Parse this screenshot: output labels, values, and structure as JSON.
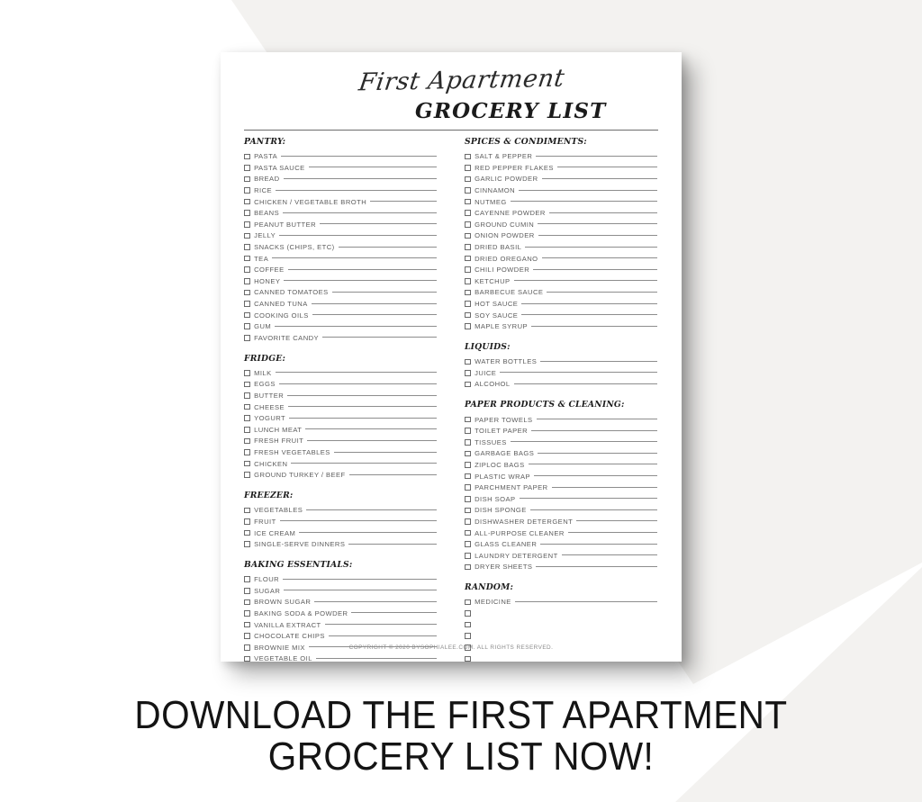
{
  "background": {
    "base_color": "#ffffff",
    "diagonal_color": "#f3f2f0"
  },
  "paper": {
    "title_script": "First Apartment",
    "title_serif": "GROCERY LIST",
    "footer": "COPYRIGHT © 2020 BYSOPHIALEE.COM. ALL RIGHTS RESERVED.",
    "left_column": [
      {
        "heading": "PANTRY:",
        "items": [
          "PASTA",
          "PASTA SAUCE",
          "BREAD",
          "RICE",
          "CHICKEN / VEGETABLE BROTH",
          "BEANS",
          "PEANUT BUTTER",
          "JELLY",
          "SNACKS (CHIPS, ETC)",
          "TEA",
          "COFFEE",
          "HONEY",
          "CANNED TOMATOES",
          "CANNED TUNA",
          "COOKING OILS",
          "GUM",
          "FAVORITE CANDY"
        ]
      },
      {
        "heading": "FRIDGE:",
        "items": [
          "MILK",
          "EGGS",
          "BUTTER",
          "CHEESE",
          "YOGURT",
          "LUNCH MEAT",
          "FRESH FRUIT",
          "FRESH VEGETABLES",
          "CHICKEN",
          "GROUND TURKEY / BEEF"
        ]
      },
      {
        "heading": "FREEZER:",
        "items": [
          "VEGETABLES",
          "FRUIT",
          "ICE CREAM",
          "SINGLE-SERVE DINNERS"
        ]
      },
      {
        "heading": "BAKING ESSENTIALS:",
        "items": [
          "FLOUR",
          "SUGAR",
          "BROWN SUGAR",
          "BAKING SODA & POWDER",
          "VANILLA EXTRACT",
          "CHOCOLATE CHIPS",
          "BROWNIE MIX",
          "VEGETABLE OIL"
        ]
      }
    ],
    "right_column": [
      {
        "heading": "SPICES & CONDIMENTS:",
        "items": [
          "SALT & PEPPER",
          "RED PEPPER FLAKES",
          "GARLIC POWDER",
          "CINNAMON",
          "NUTMEG",
          "CAYENNE POWDER",
          "GROUND CUMIN",
          "ONION POWDER",
          "DRIED BASIL",
          "DRIED OREGANO",
          "CHILI POWDER",
          "KETCHUP",
          "BARBECUE SAUCE",
          "HOT SAUCE",
          "SOY SAUCE",
          "MAPLE SYRUP"
        ]
      },
      {
        "heading": "LIQUIDS:",
        "items": [
          "WATER BOTTLES",
          "JUICE",
          "ALCOHOL"
        ]
      },
      {
        "heading": "PAPER PRODUCTS & CLEANING:",
        "items": [
          "PAPER TOWELS",
          "TOILET PAPER",
          "TISSUES",
          "GARBAGE BAGS",
          "ZIPLOC BAGS",
          "PLASTIC WRAP",
          "PARCHMENT PAPER",
          "DISH SOAP",
          "DISH SPONGE",
          "DISHWASHER DETERGENT",
          "ALL-PURPOSE CLEANER",
          "GLASS CLEANER",
          "LAUNDRY DETERGENT",
          "DRYER SHEETS"
        ]
      },
      {
        "heading": "RANDOM:",
        "items": [
          "MEDICINE",
          "",
          "",
          "",
          "",
          ""
        ]
      }
    ]
  },
  "caption": {
    "line1": "DOWNLOAD THE FIRST APARTMENT",
    "line2": "GROCERY LIST NOW!"
  }
}
